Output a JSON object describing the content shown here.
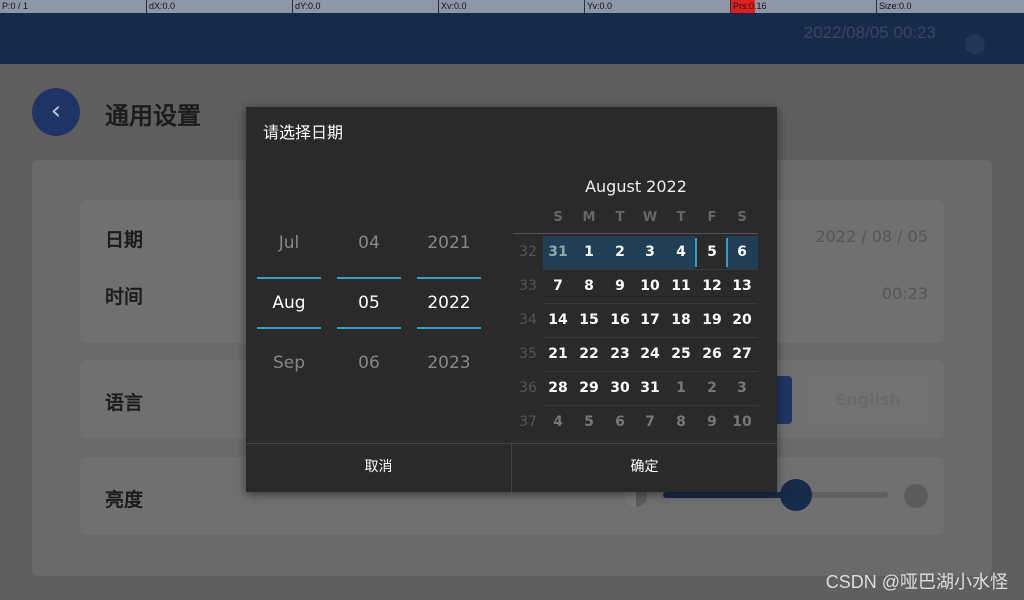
{
  "debug_bar": {
    "items": [
      "P:0 / 1",
      "dX:0.0",
      "dY:0.0",
      "Xv:0.0",
      "Yv:0.0",
      "Prs:0.16",
      "Size:0.0"
    ]
  },
  "header": {
    "datetime": "2022/08/05  00:23",
    "settings_icon": "gear-icon"
  },
  "page": {
    "title": "通用设置",
    "back_icon": "chevron-left-icon"
  },
  "settings": {
    "date_label": "日期",
    "date_value": "2022 / 08 / 05",
    "time_label": "时间",
    "time_value": "00:23",
    "language_label": "语言",
    "language_options": [
      "English"
    ],
    "brightness_label": "亮度",
    "brightness_level": 0.59
  },
  "dialog": {
    "title": "请选择日期",
    "picker": {
      "month": [
        "Jul",
        "Aug",
        "Sep"
      ],
      "day": [
        "04",
        "05",
        "06"
      ],
      "year": [
        "2021",
        "2022",
        "2023"
      ]
    },
    "calendar": {
      "title": "August 2022",
      "weekdays": [
        "S",
        "M",
        "T",
        "W",
        "T",
        "F",
        "S"
      ],
      "weeks": [
        {
          "n": "32",
          "days": [
            "31",
            "1",
            "2",
            "3",
            "4",
            "5",
            "6"
          ]
        },
        {
          "n": "33",
          "days": [
            "7",
            "8",
            "9",
            "10",
            "11",
            "12",
            "13"
          ]
        },
        {
          "n": "34",
          "days": [
            "14",
            "15",
            "16",
            "17",
            "18",
            "19",
            "20"
          ]
        },
        {
          "n": "35",
          "days": [
            "21",
            "22",
            "23",
            "24",
            "25",
            "26",
            "27"
          ]
        },
        {
          "n": "36",
          "days": [
            "28",
            "29",
            "30",
            "31",
            "1",
            "2",
            "3"
          ]
        },
        {
          "n": "37",
          "days": [
            "4",
            "5",
            "6",
            "7",
            "8",
            "9",
            "10"
          ]
        }
      ],
      "selected": "5",
      "highlight_color": "#1e3f55",
      "accent": "#3a9ec4"
    },
    "cancel": "取消",
    "ok": "确定"
  },
  "watermark": "CSDN @哑巴湖小水怪"
}
